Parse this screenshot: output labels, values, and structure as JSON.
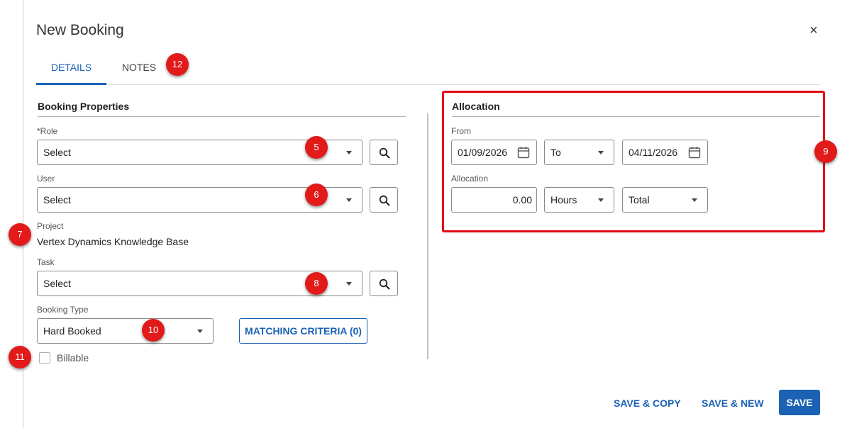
{
  "dialog": {
    "title": "New Booking",
    "close_glyph": "×"
  },
  "tabs": [
    {
      "label": "DETAILS",
      "active": true
    },
    {
      "label": "NOTES",
      "active": false
    }
  ],
  "booking_properties": {
    "heading": "Booking Properties",
    "role": {
      "label": "*Role",
      "value": "Select"
    },
    "user": {
      "label": "User",
      "value": "Select"
    },
    "project": {
      "label": "Project",
      "value": "Vertex Dynamics Knowledge Base"
    },
    "task": {
      "label": "Task",
      "value": "Select"
    },
    "booking_type": {
      "label": "Booking Type",
      "value": "Hard Booked"
    },
    "matching_criteria_label": "MATCHING CRITERIA (0)",
    "billable_label": "Billable",
    "billable_checked": false
  },
  "allocation": {
    "heading": "Allocation",
    "from_label": "From",
    "from_date": "01/09/2026",
    "to_select": "To",
    "to_date": "04/11/2026",
    "allocation_label": "Allocation",
    "amount": "0.00",
    "unit": "Hours",
    "mode": "Total"
  },
  "annotations": [
    "5",
    "6",
    "7",
    "8",
    "9",
    "10",
    "11",
    "12"
  ],
  "footer": {
    "save_copy": "SAVE & COPY",
    "save_new": "SAVE & NEW",
    "save": "SAVE"
  },
  "colors": {
    "accent": "#1b62b5",
    "highlight": "#e30613",
    "badge": "#e21a1a"
  },
  "icons": [
    "search-icon",
    "calendar-icon",
    "chevron-down-icon",
    "close-icon"
  ]
}
